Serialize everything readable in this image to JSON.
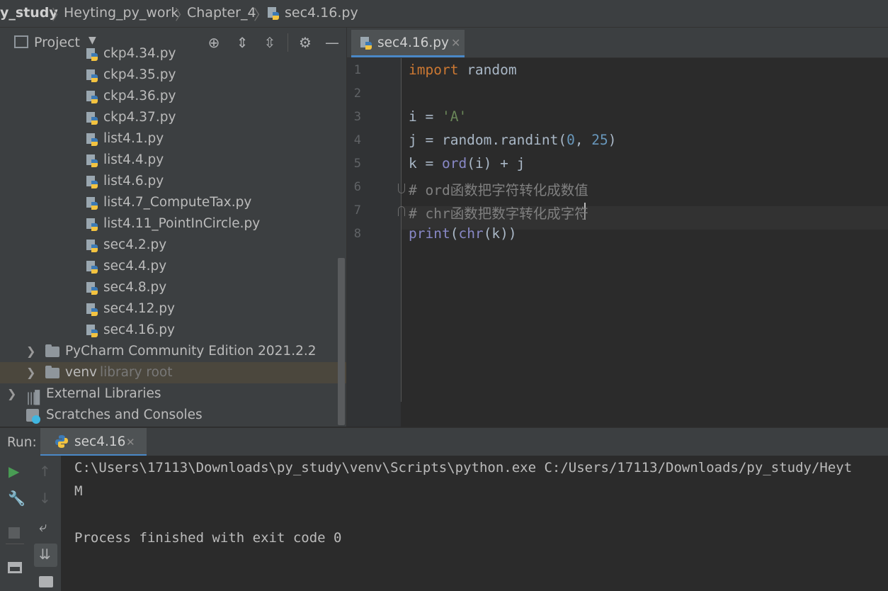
{
  "breadcrumb": [
    "y_study",
    "Heyting_py_work",
    "Chapter_4",
    "sec4.16.py"
  ],
  "project": {
    "title": "Project",
    "files": [
      "ckp4.34.py",
      "ckp4.35.py",
      "ckp4.36.py",
      "ckp4.37.py",
      "list4.1.py",
      "list4.4.py",
      "list4.6.py",
      "list4.7_ComputeTax.py",
      "list4.11_PointInCircle.py",
      "sec4.2.py",
      "sec4.4.py",
      "sec4.8.py",
      "sec4.12.py",
      "sec4.16.py"
    ],
    "folders": [
      {
        "name": "PyCharm Community Edition 2021.2.2",
        "note": ""
      },
      {
        "name": "venv",
        "note": "library root"
      }
    ],
    "external_libraries": "External Libraries",
    "scratches": "Scratches and Consoles"
  },
  "editor": {
    "tab_label": "sec4.16.py",
    "line_numbers": [
      "1",
      "2",
      "3",
      "4",
      "5",
      "6",
      "7",
      "8"
    ],
    "lines": [
      {
        "text": "import random"
      },
      {
        "text": ""
      },
      {
        "text": "i = 'A'"
      },
      {
        "text": "j = random.randint(0, 25)"
      },
      {
        "text": "k = ord(i) + j"
      },
      {
        "text": "# ord函数把字符转化成数值"
      },
      {
        "text": "# chr函数把数字转化成字符"
      },
      {
        "text": "print(chr(k))"
      }
    ]
  },
  "run": {
    "label": "Run:",
    "tab_label": "sec4.16",
    "output": [
      "C:\\Users\\17113\\Downloads\\py_study\\venv\\Scripts\\python.exe C:/Users/17113/Downloads/py_study/Heyt",
      "M",
      "",
      "Process finished with exit code 0"
    ]
  },
  "colors": {
    "accent": "#4a88c7",
    "keyword": "#cc7832",
    "string": "#6a8759",
    "number": "#6897bb",
    "builtin": "#8888c6",
    "comment": "#808080"
  }
}
